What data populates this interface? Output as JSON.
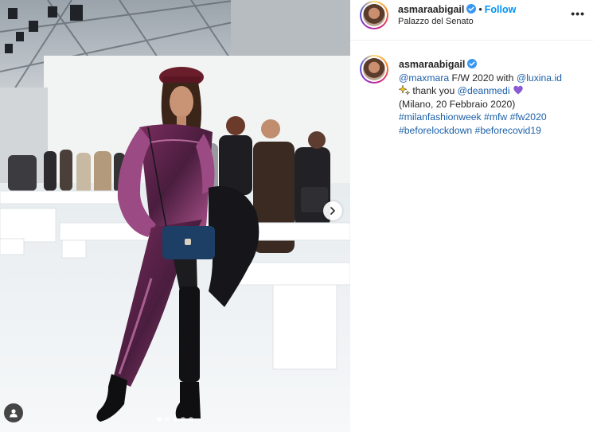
{
  "post": {
    "username": "asmaraabigail",
    "separator": "•",
    "follow_label": "Follow",
    "location": "Palazzo del Senato",
    "more_label": "•••"
  },
  "caption": {
    "username": "asmaraabigail",
    "line1": {
      "mention1": "@maxmara",
      "middle": " F/W 2020 with ",
      "mention2": "@luxina.id"
    },
    "line2": {
      "text": " thank you ",
      "mention": "@deanmedi"
    },
    "line3": "(Milano, 20 Febbraio 2020)",
    "hashtags_line1": [
      "#milanfashionweek",
      "#mfw",
      "#fw2020"
    ],
    "hashtags_line2": [
      "#beforelockdown",
      "#beforecovid19"
    ]
  },
  "carousel": {
    "slide_count": 5,
    "active_index": 0
  },
  "colors": {
    "link": "#1b5fa8",
    "follow": "#0095f6",
    "verified": "#3897f0",
    "heart": "#8a5cd1"
  }
}
